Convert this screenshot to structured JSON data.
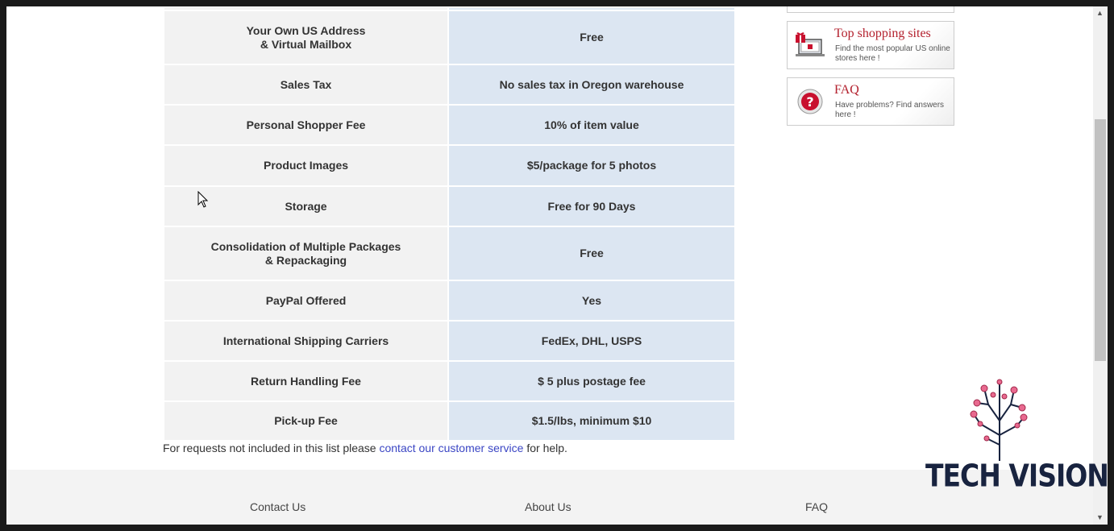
{
  "table": {
    "rows": [
      {
        "label": "Your Own US Address\n& Virtual Mailbox",
        "value": "Free"
      },
      {
        "label": "Sales Tax",
        "value": "No sales tax in Oregon warehouse"
      },
      {
        "label": "Personal Shopper Fee",
        "value": "10% of item value"
      },
      {
        "label": "Product Images",
        "value": "$5/package for 5 photos"
      },
      {
        "label": "Storage",
        "value": "Free for 90 Days"
      },
      {
        "label": "Consolidation of Multiple Packages\n& Repackaging",
        "value": "Free"
      },
      {
        "label": "PayPal Offered",
        "value": "Yes"
      },
      {
        "label": "International Shipping Carriers",
        "value": "FedEx, DHL, USPS"
      },
      {
        "label": "Return Handling Fee",
        "value": "$ 5 plus postage fee"
      },
      {
        "label": "Pick-up Fee",
        "value": "$1.5/lbs, minimum $10"
      }
    ]
  },
  "note": {
    "before": "For requests not included in this list please ",
    "link": "contact our customer service",
    "after": " for help."
  },
  "sidebar": {
    "shopping": {
      "title": "Top shopping sites",
      "desc": "Find the most popular US online stores here !",
      "icon": "laptop-gift-icon"
    },
    "faq": {
      "title": "FAQ",
      "desc": "Have problems? Find answers here !",
      "icon": "question-icon"
    }
  },
  "footer": {
    "links": [
      "Contact Us",
      "About Us",
      "FAQ"
    ]
  },
  "watermark": {
    "text": "TECH VISION"
  },
  "colors": {
    "accent": "#b3202d",
    "link": "#3b46c4",
    "value_cell": "#dce6f2",
    "label_cell": "#f2f2f2"
  }
}
